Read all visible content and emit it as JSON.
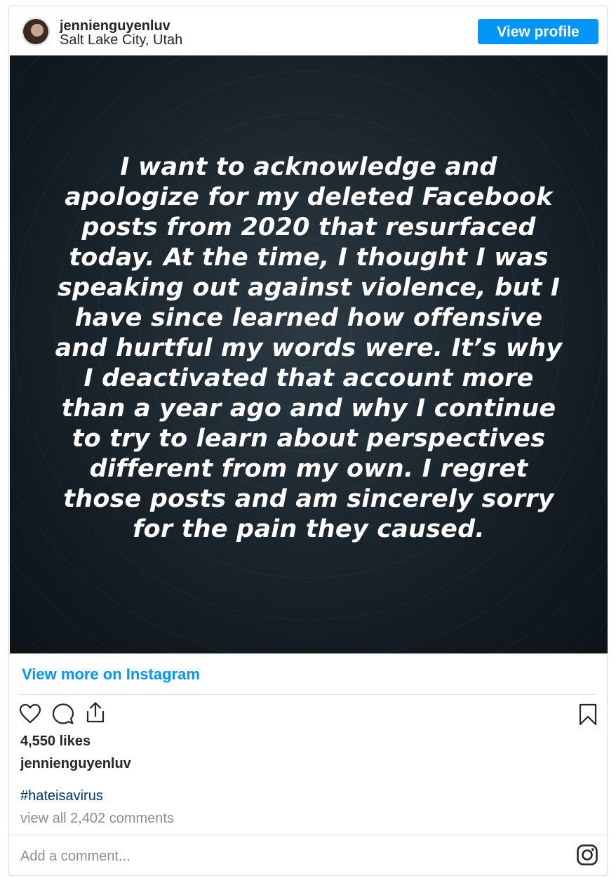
{
  "header": {
    "username": "jennienguyenluv",
    "location": "Salt Lake City, Utah",
    "view_profile_label": "View profile",
    "accent_color": "#0095f6"
  },
  "post": {
    "image_text": "I want to acknowledge and\napologize for my deleted Facebook\nposts from 2020 that resurfaced\ntoday.  At the time, I thought I was\nspeaking out against violence, but I\nhave since learned how offensive\nand hurtful my words were.  It’s why\nI deactivated that account more\nthan a year ago and why I continue\nto try to learn about perspectives\ndifferent from my own.  I regret\nthose posts and am sincerely sorry\nfor the pain they caused."
  },
  "view_more_label": "View more on Instagram",
  "actions": {
    "icons": [
      "heart-icon",
      "comment-icon",
      "share-icon",
      "bookmark-icon"
    ]
  },
  "likes_text": "4,550 likes",
  "caption": {
    "username": "jennienguyenluv",
    "hashtag": "#hateisavirus"
  },
  "comments_link": "view all 2,402 comments",
  "comment_input": {
    "placeholder": "Add a comment...",
    "value": ""
  },
  "footer_icon": "instagram-icon"
}
